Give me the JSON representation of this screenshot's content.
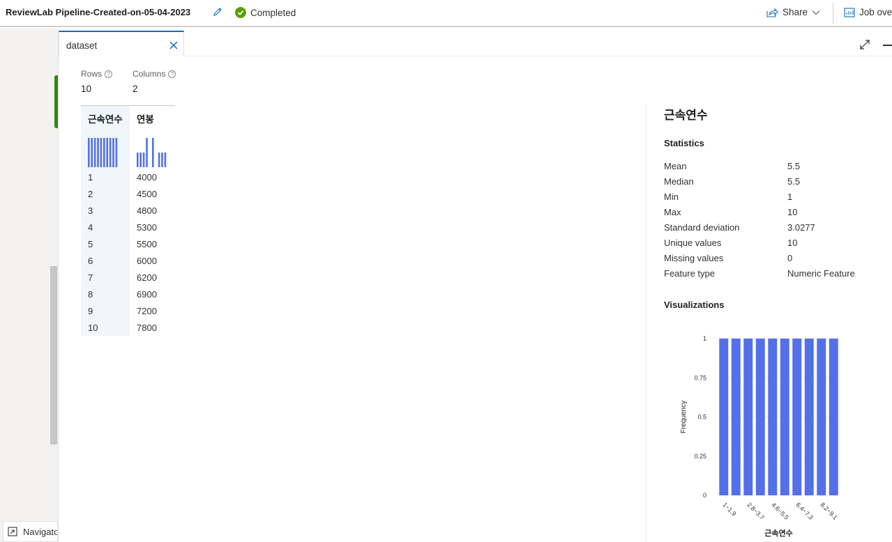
{
  "header": {
    "pipeline_title": "ReviewLab Pipeline-Created-on-05-04-2023",
    "status": "Completed",
    "share_label": "Share",
    "job_overview_label": "Job ove"
  },
  "navigator_label": "Navigato",
  "tab": {
    "label": "dataset"
  },
  "meta": {
    "rows_label": "Rows",
    "rows_value": "10",
    "columns_label": "Columns",
    "columns_value": "2"
  },
  "table": {
    "columns": [
      "근속연수",
      "연봉"
    ],
    "rows": [
      [
        "1",
        "4000"
      ],
      [
        "2",
        "4500"
      ],
      [
        "3",
        "4800"
      ],
      [
        "4",
        "5300"
      ],
      [
        "5",
        "5500"
      ],
      [
        "6",
        "6000"
      ],
      [
        "7",
        "6200"
      ],
      [
        "8",
        "6900"
      ],
      [
        "9",
        "7200"
      ],
      [
        "10",
        "7800"
      ]
    ]
  },
  "details": {
    "title": "근속연수",
    "statistics_heading": "Statistics",
    "stats": [
      {
        "k": "Mean",
        "v": "5.5"
      },
      {
        "k": "Median",
        "v": "5.5"
      },
      {
        "k": "Min",
        "v": "1"
      },
      {
        "k": "Max",
        "v": "10"
      },
      {
        "k": "Standard deviation",
        "v": "3.0277"
      },
      {
        "k": "Unique values",
        "v": "10"
      },
      {
        "k": "Missing values",
        "v": "0"
      },
      {
        "k": "Feature type",
        "v": "Numeric Feature"
      }
    ],
    "visualizations_heading": "Visualizations"
  },
  "chart_data": {
    "type": "bar",
    "categories": [
      "1~1.9",
      "1.9~2.8",
      "2.8~3.7",
      "3.7~4.6",
      "4.6~5.5",
      "5.5~6.4",
      "6.4~7.3",
      "7.3~8.2",
      "8.2~9.1",
      "9.1~10"
    ],
    "tick_labels_shown": [
      "1~1.9",
      "2.8~3.7",
      "4.6~5.5",
      "6.4~7.3",
      "8.2~9.1"
    ],
    "values": [
      1,
      1,
      1,
      1,
      1,
      1,
      1,
      1,
      1,
      1
    ],
    "yticks": [
      "0",
      "0.25",
      "0.5",
      "0.75",
      "1"
    ],
    "ylim": [
      0,
      1
    ],
    "xlabel": "근속연수",
    "ylabel": "Frequency",
    "bar_color": "#5470e8"
  },
  "colors": {
    "accent": "#0f6cbd",
    "success": "#57a300",
    "bar": "#5470e8"
  }
}
